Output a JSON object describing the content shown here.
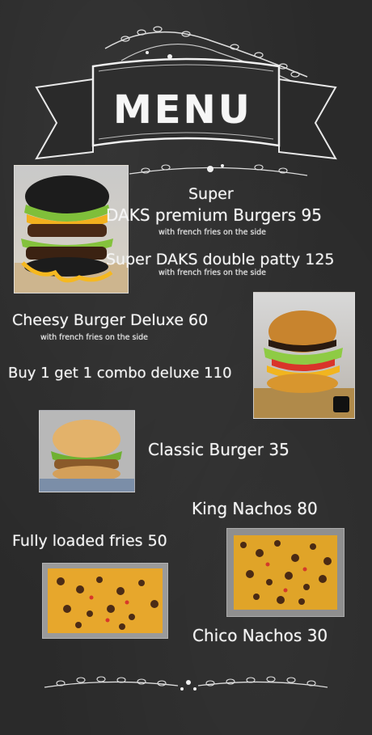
{
  "header": {
    "title": "MENU"
  },
  "items": {
    "super_prefix": "Super",
    "daks_premium": "DAKS premium Burgers 95",
    "daks_premium_note": "with french fries on the side",
    "daks_double": "Super DAKS double patty 125",
    "daks_double_note": "with french fries on the side",
    "cheesy_deluxe": "Cheesy Burger Deluxe 60",
    "cheesy_deluxe_note": "with french fries on the side",
    "buy1get1": "Buy 1 get 1 combo deluxe 110",
    "classic": "Classic Burger 35",
    "king_nachos": "King Nachos 80",
    "loaded_fries": "Fully loaded fries 50",
    "chico_nachos": "Chico Nachos 30"
  },
  "colors": {
    "board": "#2a2a2a",
    "chalk": "#f4f4f4"
  }
}
